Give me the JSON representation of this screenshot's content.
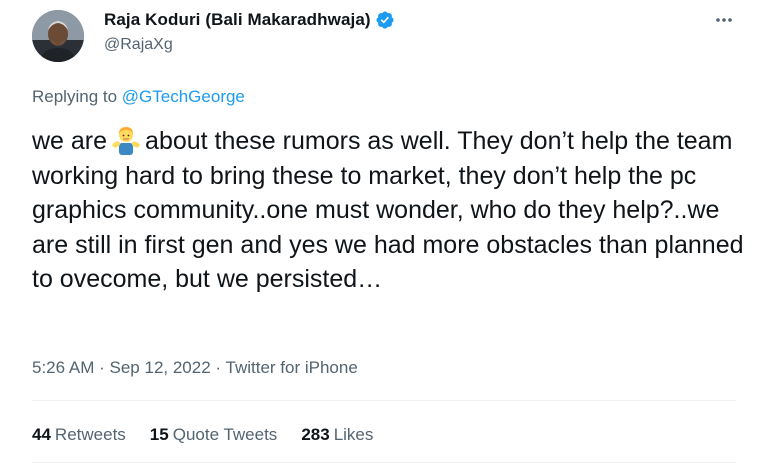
{
  "author": {
    "display_name": "Raja Koduri (Bali Makaradhwaja)",
    "handle": "@RajaXg",
    "verified": true
  },
  "reply": {
    "prefix": "Replying to",
    "mention": "@GTechGeorge"
  },
  "tweet": {
    "text_before_emoji": "we are",
    "emoji": "person-shrugging",
    "text_after_emoji": "about these rumors as well. They don’t help the team working hard to bring these to market, they don’t help the pc graphics community..one must wonder, who do they help?..we are still in first gen and yes we had more obstacles than planned to ovecome, but we persisted…"
  },
  "meta": {
    "time": "5:26 AM",
    "separator1": "·",
    "date": "Sep 12, 2022",
    "separator2": "·",
    "source": "Twitter for iPhone"
  },
  "stats": {
    "retweets_count": "44",
    "retweets_label": "Retweets",
    "quotes_count": "15",
    "quotes_label": "Quote Tweets",
    "likes_count": "283",
    "likes_label": "Likes"
  },
  "colors": {
    "link": "#1d9bf0",
    "secondary_text": "#536471",
    "primary_text": "#0f1419",
    "divider": "#eff3f4"
  },
  "icons": [
    "verified-badge-icon",
    "more-options-icon",
    "person-shrugging-emoji"
  ]
}
